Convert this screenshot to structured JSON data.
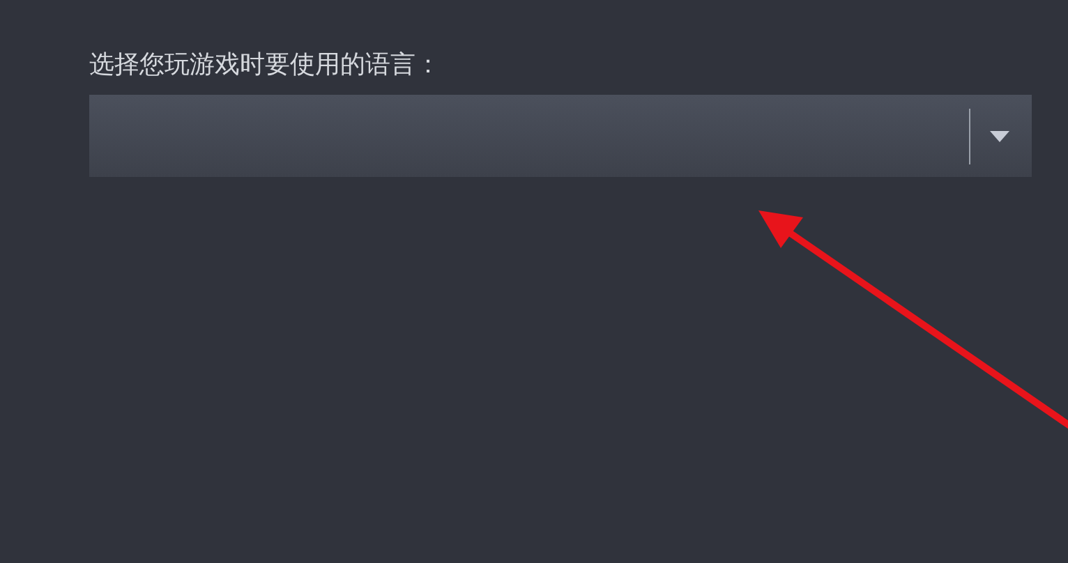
{
  "language_select": {
    "label": "选择您玩游戏时要使用的语言："
  }
}
